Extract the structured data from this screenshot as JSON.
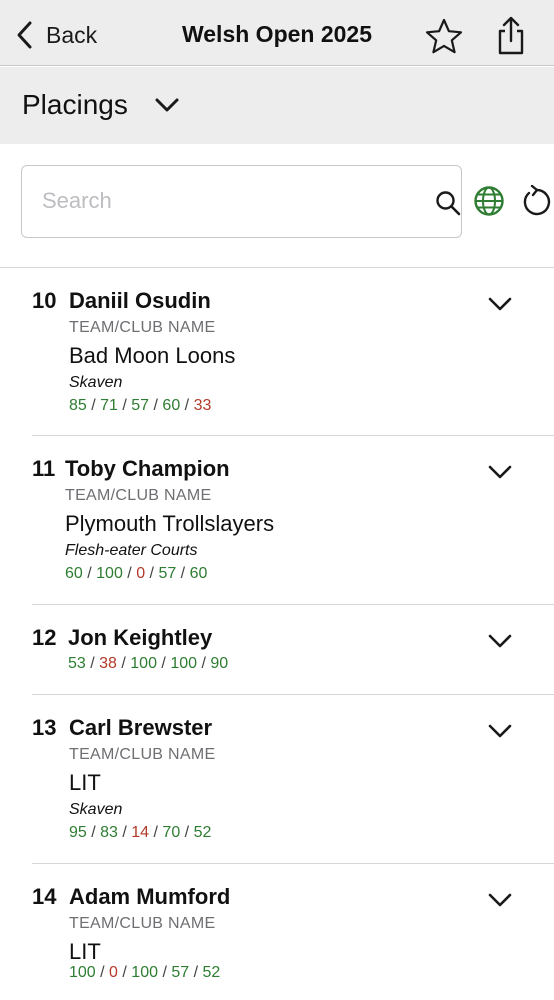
{
  "header": {
    "back_label": "Back",
    "title": "Welsh Open 2025"
  },
  "subheader": {
    "selected": "Placings"
  },
  "search": {
    "placeholder": "Search",
    "value": ""
  },
  "team_label": "TEAM/CLUB NAME",
  "colors": {
    "pass": "#2e7d32",
    "fail": "#b23a2a",
    "bar_bg": "#ededed"
  },
  "entries": [
    {
      "rank": "10",
      "name": "Daniil Osudin",
      "team": "Bad Moon Loons",
      "faction": "Skaven",
      "scores": [
        {
          "v": "85",
          "status": "good"
        },
        {
          "v": "71",
          "status": "good"
        },
        {
          "v": "57",
          "status": "good"
        },
        {
          "v": "60",
          "status": "good"
        },
        {
          "v": "33",
          "status": "bad"
        }
      ]
    },
    {
      "rank": "11",
      "name": "Toby Champion",
      "team": "Plymouth Trollslayers",
      "faction": "Flesh-eater Courts",
      "scores": [
        {
          "v": "60",
          "status": "good"
        },
        {
          "v": "100",
          "status": "good"
        },
        {
          "v": "0",
          "status": "bad"
        },
        {
          "v": "57",
          "status": "good"
        },
        {
          "v": "60",
          "status": "good"
        }
      ]
    },
    {
      "rank": "12",
      "name": "Jon Keightley",
      "team": "",
      "faction": "",
      "scores": [
        {
          "v": "53",
          "status": "good"
        },
        {
          "v": "38",
          "status": "bad"
        },
        {
          "v": "100",
          "status": "good"
        },
        {
          "v": "100",
          "status": "good"
        },
        {
          "v": "90",
          "status": "good"
        }
      ]
    },
    {
      "rank": "13",
      "name": "Carl Brewster",
      "team": "LIT",
      "faction": "Skaven",
      "scores": [
        {
          "v": "95",
          "status": "good"
        },
        {
          "v": "83",
          "status": "good"
        },
        {
          "v": "14",
          "status": "bad"
        },
        {
          "v": "70",
          "status": "good"
        },
        {
          "v": "52",
          "status": "good"
        }
      ]
    },
    {
      "rank": "14",
      "name": "Adam Mumford",
      "team": "LIT",
      "faction": "",
      "scores": [
        {
          "v": "100",
          "status": "good"
        },
        {
          "v": "0",
          "status": "bad"
        },
        {
          "v": "100",
          "status": "good"
        },
        {
          "v": "57",
          "status": "good"
        },
        {
          "v": "52",
          "status": "good"
        }
      ]
    }
  ]
}
